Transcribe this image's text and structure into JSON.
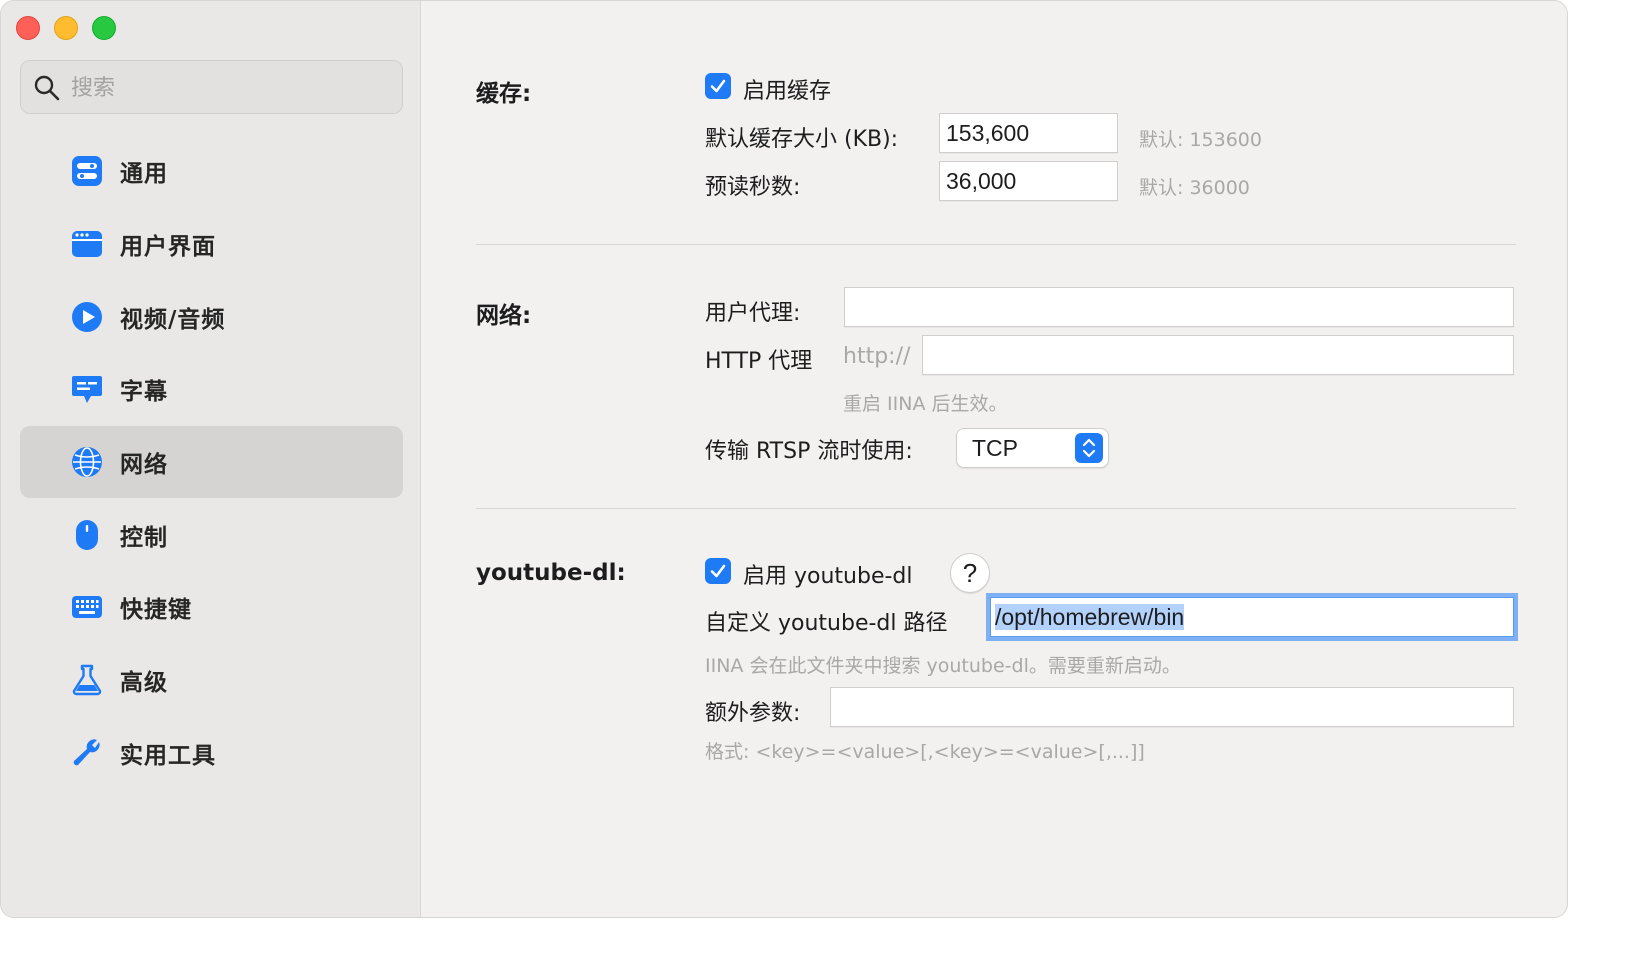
{
  "sidebar": {
    "search_placeholder": "搜索",
    "items": [
      {
        "label": "通用",
        "icon": "toggles-icon"
      },
      {
        "label": "用户界面",
        "icon": "window-icon"
      },
      {
        "label": "视频/音频",
        "icon": "play-icon"
      },
      {
        "label": "字幕",
        "icon": "subtitle-bubble-icon"
      },
      {
        "label": "网络",
        "icon": "globe-icon",
        "active": true
      },
      {
        "label": "控制",
        "icon": "mouse-icon"
      },
      {
        "label": "快捷键",
        "icon": "keyboard-icon"
      },
      {
        "label": "高级",
        "icon": "flask-icon"
      },
      {
        "label": "实用工具",
        "icon": "wrench-icon"
      }
    ]
  },
  "cache": {
    "section_label": "缓存:",
    "enable_label": "启用缓存",
    "enable_checked": true,
    "size_label": "默认缓存大小 (KB):",
    "size_value": "153,600",
    "size_default": "默认: 153600",
    "readahead_label": "预读秒数:",
    "readahead_value": "36,000",
    "readahead_default": "默认: 36000"
  },
  "network": {
    "section_label": "网络:",
    "user_agent_label": "用户代理:",
    "user_agent_value": "",
    "http_proxy_label": "HTTP 代理",
    "http_proxy_prefix": "http://",
    "http_proxy_value": "",
    "restart_hint": "重启 IINA 后生效。",
    "rtsp_label": "传输 RTSP 流时使用:",
    "rtsp_value": "TCP"
  },
  "ytdl": {
    "section_label": "youtube-dl:",
    "enable_label": "启用 youtube-dl",
    "enable_checked": true,
    "help_label": "?",
    "path_label": "自定义 youtube-dl 路径",
    "path_value": "/opt/homebrew/bin",
    "path_hint": "IINA 会在此文件夹中搜索 youtube-dl。需要重新启动。",
    "args_label": "额外参数:",
    "args_value": "",
    "args_hint": "格式: <key>=<value>[,<key>=<value>[,...]]"
  },
  "colors": {
    "accent": "#1f7af5",
    "sidebar_bg": "#e9e8e7",
    "content_bg": "#f2f1f0",
    "active_item_bg": "#d5d4d3",
    "focus_ring": "#7fb0f3"
  }
}
